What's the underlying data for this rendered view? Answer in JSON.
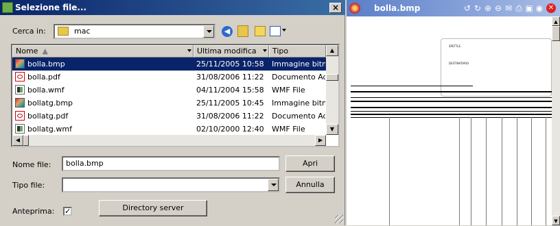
{
  "dialog": {
    "title": "Selezione file...",
    "close": "×",
    "lookin_label": "Cerca in:",
    "lookin_value": "mac",
    "columns": [
      "Nome",
      "Ultima modifica",
      "Tipo"
    ],
    "files": [
      {
        "name": "bolla.bmp",
        "modified": "25/11/2005 10:58",
        "type": "Immagine bitmap",
        "icon": "bmp-file-icon",
        "selected": true
      },
      {
        "name": "bolla.pdf",
        "modified": "31/08/2006 11:22",
        "type": "Documento Adobe",
        "icon": "pdf-file-icon",
        "selected": false
      },
      {
        "name": "bolla.wmf",
        "modified": "04/11/2004 15:58",
        "type": "WMF File",
        "icon": "wmf-file-icon",
        "selected": false
      },
      {
        "name": "bollatg.bmp",
        "modified": "25/11/2005 10:45",
        "type": "Immagine bitmap",
        "icon": "bmp-file-icon",
        "selected": false
      },
      {
        "name": "bollatg.pdf",
        "modified": "31/08/2006 11:22",
        "type": "Documento Adobe",
        "icon": "pdf-file-icon",
        "selected": false
      },
      {
        "name": "bollatg.wmf",
        "modified": "02/10/2000 12:40",
        "type": "WMF File",
        "icon": "wmf-file-icon",
        "selected": false
      }
    ],
    "filename_label": "Nome file:",
    "filename_value": "bolla.bmp",
    "open_button": "Apri",
    "filetype_label": "Tipo file:",
    "filetype_value": "",
    "cancel_button": "Annulla",
    "preview_label": "Anteprima:",
    "preview_checked": "✓",
    "directory_button": "Directory server"
  },
  "viewer": {
    "title": "bolla.bmp",
    "doc_labels": {
      "sender": "SPETTLE",
      "recipient": "DESTINATARIO"
    }
  },
  "colors": {
    "selection": "#0a246a",
    "titlebar": "#0a246a",
    "viewer_bar": "#5a7ec8"
  }
}
